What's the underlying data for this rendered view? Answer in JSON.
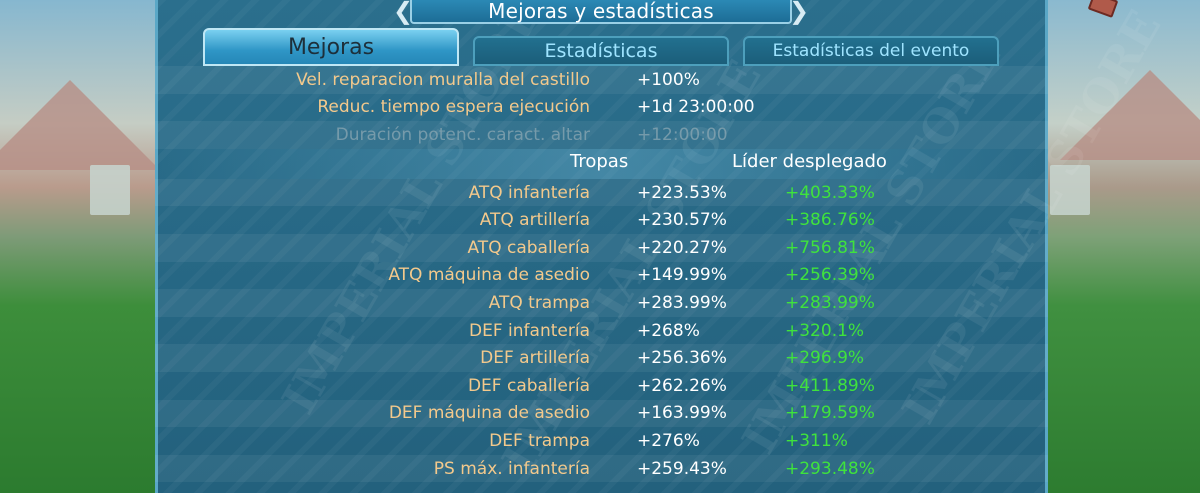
{
  "window": {
    "title": "Mejoras y estadísticas"
  },
  "tabs": [
    {
      "label": "Mejoras",
      "active": true
    },
    {
      "label": "Estadísticas",
      "active": false
    },
    {
      "label": "Estadísticas del evento",
      "active": false
    }
  ],
  "general_stats": [
    {
      "label": "Vel. reparacion muralla del castillo",
      "value": "+100%"
    },
    {
      "label": "Reduc. tiempo espera ejecución",
      "value": "+1d 23:00:00"
    },
    {
      "label": "Duración potenc. caract. altar",
      "value": "+12:00:00"
    }
  ],
  "columns": {
    "troops": "Tropas",
    "leader": "Líder desplegado"
  },
  "troop_stats": [
    {
      "label": "ATQ infantería",
      "troops": "+223.53%",
      "leader": "+403.33%"
    },
    {
      "label": "ATQ artillería",
      "troops": "+230.57%",
      "leader": "+386.76%"
    },
    {
      "label": "ATQ caballería",
      "troops": "+220.27%",
      "leader": "+756.81%"
    },
    {
      "label": "ATQ máquina de asedio",
      "troops": "+149.99%",
      "leader": "+256.39%"
    },
    {
      "label": "ATQ trampa",
      "troops": "+283.99%",
      "leader": "+283.99%"
    },
    {
      "label": "DEF infantería",
      "troops": "+268%",
      "leader": "+320.1%"
    },
    {
      "label": "DEF artillería",
      "troops": "+256.36%",
      "leader": "+296.9%"
    },
    {
      "label": "DEF caballería",
      "troops": "+262.26%",
      "leader": "+411.89%"
    },
    {
      "label": "DEF máquina de asedio",
      "troops": "+163.99%",
      "leader": "+179.59%"
    },
    {
      "label": "DEF trampa",
      "troops": "+276%",
      "leader": "+311%"
    },
    {
      "label": "PS máx. infantería",
      "troops": "+259.43%",
      "leader": "+293.48%"
    }
  ],
  "colors": {
    "label": "#f3c98c",
    "value": "#ffffff",
    "leader_value": "#3fe33c",
    "panel": "#2b6f8d"
  },
  "watermark_text": "IMPERIAL STORE",
  "icons": [
    "chevron-left-icon",
    "chevron-right-icon",
    "close-corner-icon"
  ]
}
